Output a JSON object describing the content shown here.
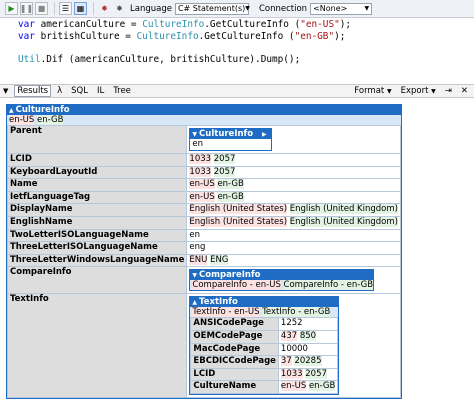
{
  "toolbar": {
    "language_label": "Language",
    "language_value": "C# Statement(s)",
    "connection_label": "Connection",
    "connection_value": "<None>"
  },
  "editor": {
    "lines": [
      [
        {
          "t": "var ",
          "c": "kw"
        },
        {
          "t": "americanCulture = ",
          "c": ""
        },
        {
          "t": "CultureInfo",
          "c": "cls"
        },
        {
          "t": ".GetCultureInfo (",
          "c": ""
        },
        {
          "t": "\"en-US\"",
          "c": "str"
        },
        {
          "t": ");",
          "c": ""
        }
      ],
      [
        {
          "t": "var ",
          "c": "kw"
        },
        {
          "t": "britishCulture = ",
          "c": ""
        },
        {
          "t": "CultureInfo",
          "c": "cls"
        },
        {
          "t": ".GetCultureInfo (",
          "c": ""
        },
        {
          "t": "\"en-GB\"",
          "c": "str"
        },
        {
          "t": ");",
          "c": ""
        }
      ],
      [
        {
          "t": "",
          "c": ""
        }
      ],
      [
        {
          "t": "Util",
          "c": "cls"
        },
        {
          "t": ".Dif (americanCulture, britishCulture).Dump();",
          "c": ""
        }
      ]
    ]
  },
  "result_tabs": {
    "results": "Results",
    "lambda": "λ",
    "sql": "SQL",
    "il": "IL",
    "tree": "Tree",
    "format": "Format",
    "export": "Export"
  },
  "result": {
    "header": "CultureInfo",
    "summary_us": "en-US",
    "summary_gb": "en-GB",
    "parent": {
      "header": "CultureInfo",
      "value": "en"
    },
    "rows": [
      {
        "key": "LCID",
        "us": "1033",
        "gb": "2057"
      },
      {
        "key": "KeyboardLayoutId",
        "us": "1033",
        "gb": "2057"
      },
      {
        "key": "Name",
        "us": "en-US",
        "gb": "en-GB"
      },
      {
        "key": "IetfLanguageTag",
        "us": "en-US",
        "gb": "en-GB"
      },
      {
        "key": "DisplayName",
        "us": "English (United States)",
        "gb": "English (United Kingdom)"
      },
      {
        "key": "EnglishName",
        "us": "English (United States)",
        "gb": "English (United Kingdom)"
      },
      {
        "key": "TwoLetterISOLanguageName",
        "same": "en"
      },
      {
        "key": "ThreeLetterISOLanguageName",
        "same": "eng"
      },
      {
        "key": "ThreeLetterWindowsLanguageName",
        "us": "ENU",
        "gb": "ENG"
      }
    ],
    "compare_info": {
      "key": "CompareInfo",
      "header": "CompareInfo",
      "us": "CompareInfo - en-US",
      "gb": "CompareInfo - en-GB"
    },
    "text_info": {
      "key": "TextInfo",
      "header": "TextInfo",
      "us": "TextInfo - en-US",
      "gb": "TextInfo - en-GB",
      "rows": [
        {
          "key": "ANSICodePage",
          "same": "1252"
        },
        {
          "key": "OEMCodePage",
          "us": "437",
          "gb": "850"
        },
        {
          "key": "MacCodePage",
          "same": "10000"
        },
        {
          "key": "EBCDICCodePage",
          "us": "37",
          "gb": "20285"
        },
        {
          "key": "LCID",
          "us": "1033",
          "gb": "2057"
        },
        {
          "key": "CultureName",
          "us": "en-US",
          "gb": "en-GB"
        }
      ]
    }
  }
}
